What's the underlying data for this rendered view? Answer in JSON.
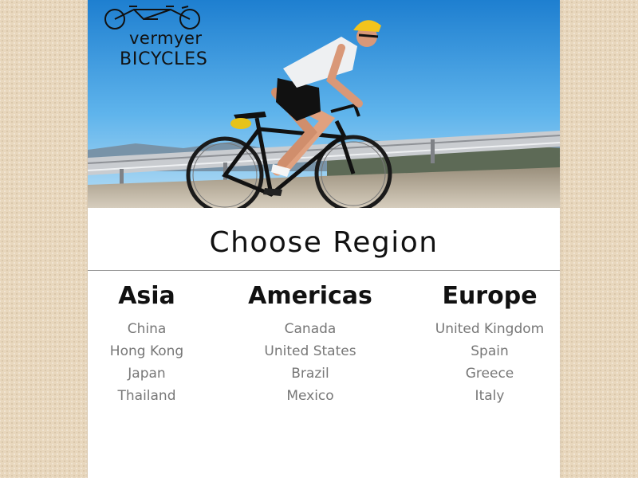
{
  "logo": {
    "line1": "vermyer",
    "line2": "BICYCLES"
  },
  "heading": "Choose Region",
  "regions": [
    {
      "title": "Asia",
      "countries": [
        "China",
        "Hong Kong",
        "Japan",
        "Thailand"
      ]
    },
    {
      "title": "Americas",
      "countries": [
        "Canada",
        "United States",
        "Brazil",
        "Mexico"
      ]
    },
    {
      "title": "Europe",
      "countries": [
        "United Kingdom",
        "Spain",
        "Greece",
        "Italy"
      ]
    }
  ],
  "colors": {
    "page_background": "#e8d7bd",
    "country_text": "#777777",
    "heading_text": "#111111"
  },
  "hero": {
    "image_subject": "cyclist-riding-road-bike-in-mountains"
  }
}
